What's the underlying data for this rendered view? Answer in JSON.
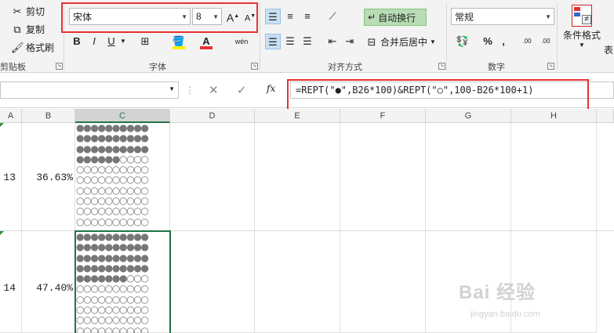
{
  "clipboard": {
    "cut_label": "剪切",
    "copy_label": "复制",
    "painter_label": "格式刷",
    "group_label": "剪贴板"
  },
  "font": {
    "family_value": "宋体",
    "size_value": "8",
    "grow_label": "A",
    "shrink_label": "A",
    "bold_label": "B",
    "italic_label": "I",
    "underline_label": "U",
    "phonetic_label": "wén",
    "font_color_label": "A",
    "group_label": "字体"
  },
  "alignment": {
    "wrap_text_label": "自动换行",
    "merge_label": "合并后居中",
    "group_label": "对齐方式"
  },
  "number": {
    "format_value": "常规",
    "percent_label": "%",
    "comma_label": ",",
    "inc_decimal_label": ".00",
    "dec_decimal_label": ".00",
    "group_label": "数字"
  },
  "styles": {
    "conditional_label": "条件格式",
    "table_label": "表"
  },
  "formula_bar": {
    "cancel_icon": "✕",
    "enter_icon": "✓",
    "fx_label": "fx",
    "formula": "=REPT(\"●\",B26*100)&REPT(\"○\",100-B26*100+1)"
  },
  "columns": [
    "A",
    "B",
    "C",
    "D",
    "E",
    "F",
    "G",
    "H"
  ],
  "rows": [
    {
      "a": "13",
      "b": "36.63%",
      "dots": "●●●●●●●●●●\n●●●●●●●●●●\n●●●●●●●●●●\n●●●●●●○○○○\n○○○○○○○○○○\n○○○○○○○○○○\n○○○○○○○○○○\n○○○○○○○○○○\n○○○○○○○○○○\n○○○○○○○○○○"
    },
    {
      "a": "14",
      "b": "47.40%",
      "dots": "●●●●●●●●●●\n●●●●●●●●●●\n●●●●●●●●●●\n●●●●●●●●●●\n●●●●●●●○○○\n○○○○○○○○○○\n○○○○○○○○○○\n○○○○○○○○○○\n○○○○○○○○○○\n○○○○○○○○○○"
    }
  ],
  "watermark": {
    "main": "Bai 经验",
    "sub": "jingyan.baidu.com"
  },
  "colors": {
    "highlight": "#e53333",
    "excel_green": "#217346",
    "wrap_active": "#b8dcb3"
  }
}
